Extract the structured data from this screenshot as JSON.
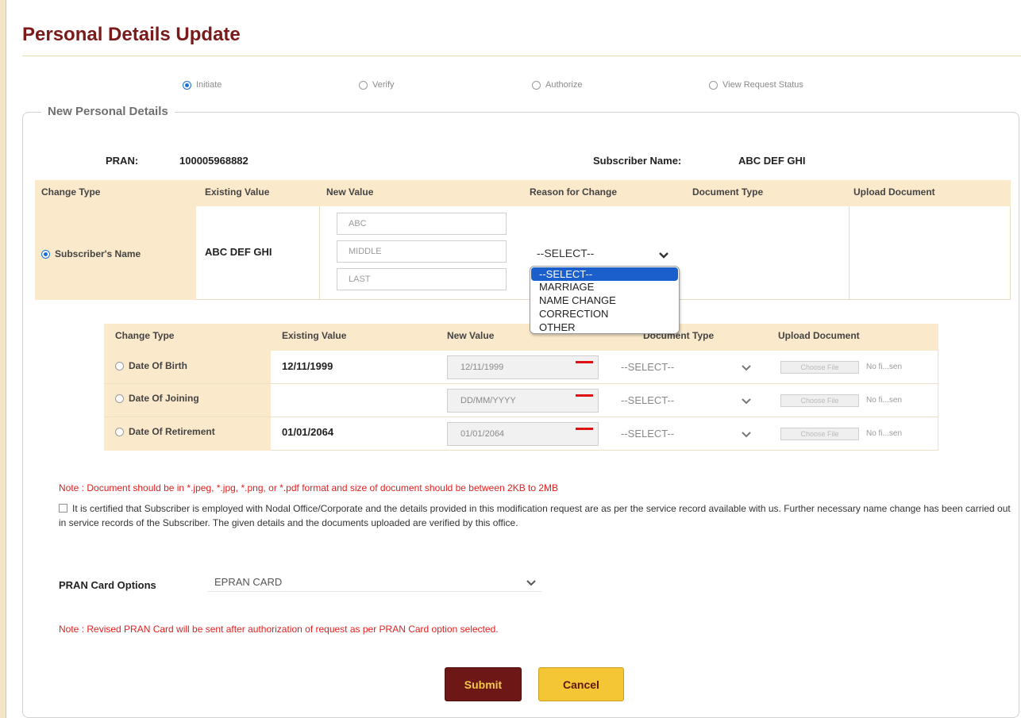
{
  "page": {
    "title": "Personal Details Update"
  },
  "steps": [
    {
      "label": "Initiate",
      "checked": true
    },
    {
      "label": "Verify",
      "checked": false
    },
    {
      "label": "Authorize",
      "checked": false
    },
    {
      "label": "View Request Status",
      "checked": false
    }
  ],
  "section": {
    "legend": "New Personal Details"
  },
  "subscriber": {
    "pran_label": "PRAN:",
    "pran_value": "100005968882",
    "name_label": "Subscriber Name:",
    "name_value": "ABC DEF GHI"
  },
  "name_table": {
    "headers": [
      "Change Type",
      "Existing Value",
      "New Value",
      "Reason for Change",
      "Document Type",
      "Upload Document"
    ],
    "row": {
      "change_type": "Subscriber's Name",
      "existing_value": "ABC DEF GHI",
      "placeholders": {
        "first": "ABC",
        "middle": "MIDDLE",
        "last": "LAST"
      },
      "reason_selected": "--SELECT--"
    }
  },
  "reason_dropdown": {
    "options": [
      "--SELECT--",
      "MARRIAGE",
      "NAME CHANGE",
      "CORRECTION",
      "OTHER"
    ],
    "selected_index": 0
  },
  "date_table": {
    "headers": [
      "Change Type",
      "Existing Value",
      "New Value",
      "Document Type",
      "Upload Document"
    ],
    "rows": [
      {
        "change_type": "Date Of Birth",
        "existing": "12/11/1999",
        "new_value": "12/11/1999",
        "doc_type": "--SELECT--",
        "upload_label": "Choose File",
        "file_status": "No fi...sen"
      },
      {
        "change_type": "Date Of Joining",
        "existing": "",
        "new_value": "DD/MM/YYYY",
        "doc_type": "--SELECT--",
        "upload_label": "Choose File",
        "file_status": "No fi...sen"
      },
      {
        "change_type": "Date Of Retirement",
        "existing": "01/01/2064",
        "new_value": "01/01/2064",
        "doc_type": "--SELECT--",
        "upload_label": "Choose File",
        "file_status": "No fi...sen"
      }
    ]
  },
  "notes": {
    "document": "Note : Document should be in *.jpeg, *.jpg, *.png, or *.pdf format and size of document should be between 2KB to 2MB",
    "certify": "It is certified that Subscriber is employed with Nodal Office/Corporate and the details provided in this modification request are as per the service record available with us. Further necessary name change has been carried out in service records of the Subscriber. The given details and the documents uploaded are verified by this office.",
    "pran_card": "Note : Revised PRAN Card will be sent after authorization of request as per PRAN Card option selected."
  },
  "pran_card": {
    "label": "PRAN Card Options",
    "selected": "EPRAN CARD"
  },
  "buttons": {
    "submit": "Submit",
    "cancel": "Cancel"
  },
  "colors": {
    "title": "#7a1a1a",
    "band": "#fbe9cb",
    "note": "#e02020",
    "select_highlight": "#1a5fcc"
  }
}
